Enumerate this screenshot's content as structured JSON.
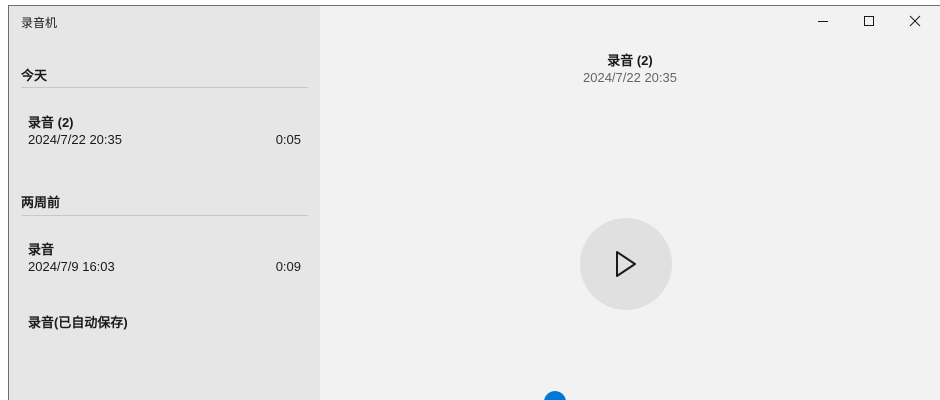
{
  "app": {
    "title": "录音机"
  },
  "window_controls": {
    "minimize_icon": "minimize-icon",
    "maximize_icon": "maximize-icon",
    "close_icon": "close-icon"
  },
  "sidebar": {
    "groups": [
      {
        "header": "今天",
        "items": [
          {
            "name": "录音 (2)",
            "date": "2024/7/22 20:35",
            "duration": "0:05"
          }
        ]
      },
      {
        "header": "两周前",
        "items": [
          {
            "name": "录音",
            "date": "2024/7/9 16:03",
            "duration": "0:09"
          },
          {
            "name": "录音(已自动保存)",
            "date": "",
            "duration": ""
          }
        ]
      }
    ]
  },
  "player": {
    "title": "录音 (2)",
    "date": "2024/7/22 20:35",
    "play_icon": "play-icon",
    "progress": 0.34,
    "accent_color": "#0078d7"
  }
}
